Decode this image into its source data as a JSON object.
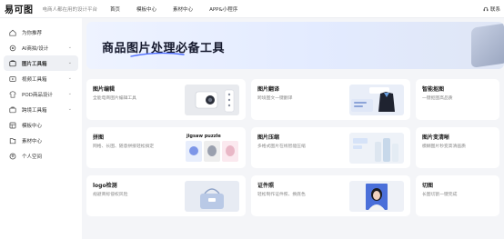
{
  "topbar": {
    "logo_text": "易可图",
    "slogan": "电商人都在用的设计平台",
    "nav": [
      "首页",
      "模板中心",
      "素材中心",
      "APP&小程序"
    ],
    "contact": "联系"
  },
  "sidebar": {
    "items": [
      {
        "label": "为你推荐",
        "icon": "home-icon",
        "chevron": false,
        "active": false
      },
      {
        "label": "AI商拍/设计",
        "icon": "ai-design-icon",
        "chevron": true,
        "active": false
      },
      {
        "label": "图片工具箱",
        "icon": "image-toolbox-icon",
        "chevron": true,
        "active": true
      },
      {
        "label": "视频工具箱",
        "icon": "video-toolbox-icon",
        "chevron": true,
        "active": false
      },
      {
        "label": "POD商品设计",
        "icon": "pod-icon",
        "chevron": true,
        "active": false
      },
      {
        "label": "跨境工具箱",
        "icon": "crossborder-icon",
        "chevron": true,
        "active": false
      },
      {
        "label": "模板中心",
        "icon": "template-icon",
        "chevron": false,
        "active": false
      },
      {
        "label": "素材中心",
        "icon": "material-icon",
        "chevron": false,
        "active": false
      },
      {
        "label": "个人空间",
        "icon": "user-icon",
        "chevron": false,
        "active": false
      }
    ]
  },
  "banner": {
    "title": "商品图片处理必备工具"
  },
  "cards": [
    {
      "title": "图片编辑",
      "desc": "全能电商图片编辑工具"
    },
    {
      "title": "图片翻译",
      "desc": "跨境图文一键翻译"
    },
    {
      "title": "智能抠图",
      "desc": "一键抠图高品质"
    },
    {
      "title": "拼图",
      "desc": "网格、长图、随意拼接轻松搞定"
    },
    {
      "title": "图片压缩",
      "desc": "多格式图片在线智能压缩"
    },
    {
      "title": "图片变清晰",
      "desc": "模糊图片秒变高清画质"
    },
    {
      "title": "logo检测",
      "desc": "规避商标侵权风险"
    },
    {
      "title": "证件照",
      "desc": "轻松制作证件照、换底色"
    },
    {
      "title": "切图",
      "desc": "长图切割一键完成"
    }
  ],
  "puzzle_tag": "jigsaw puzzle",
  "colors": {
    "accent": "#4b6bff",
    "active_bg": "#eef0f4"
  }
}
